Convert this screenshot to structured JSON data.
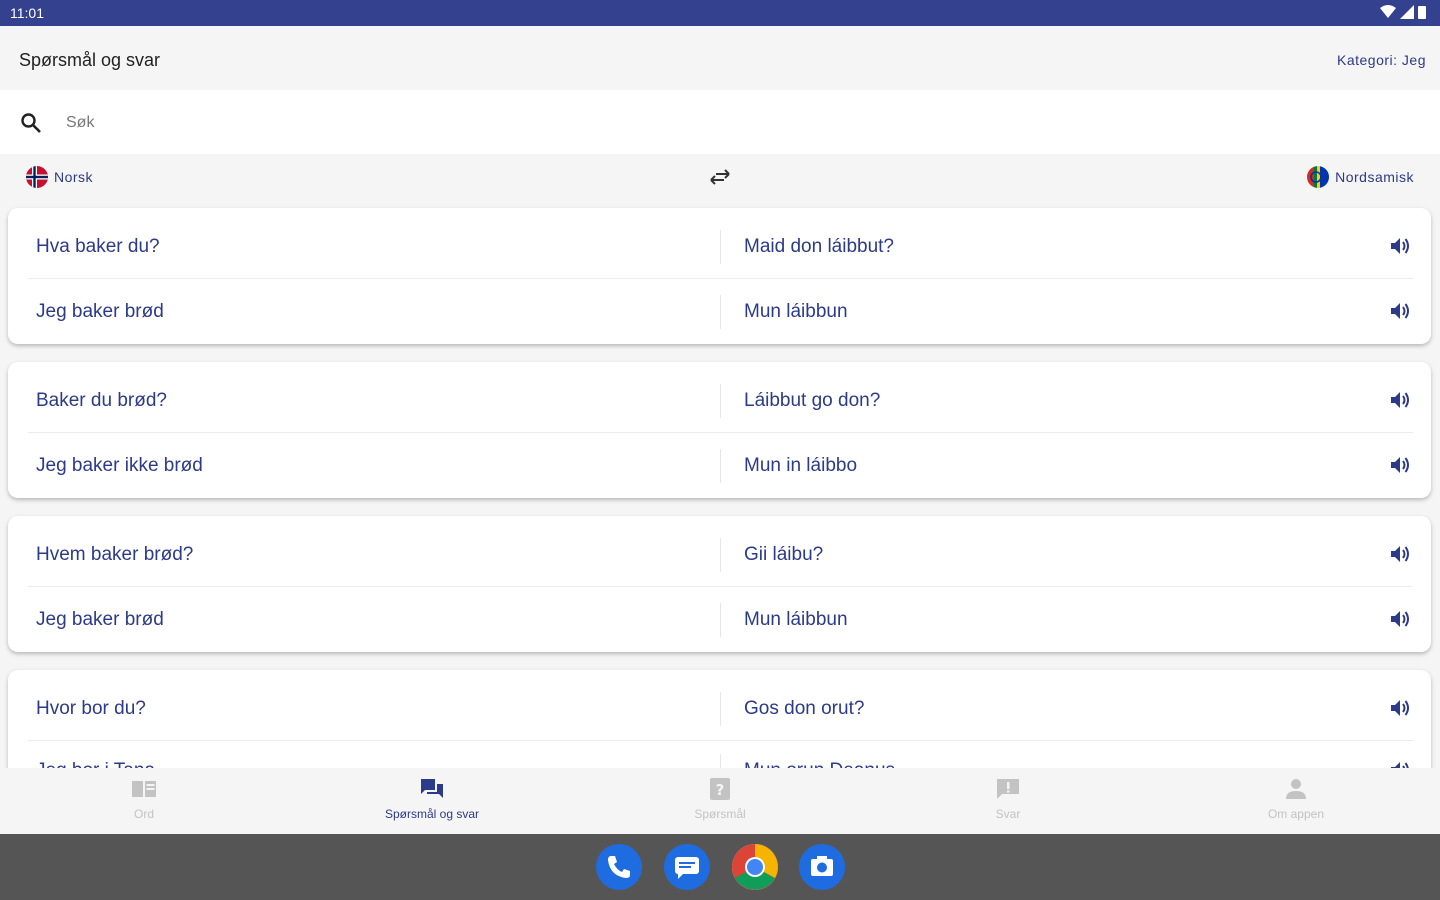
{
  "status_bar": {
    "time": "11:01"
  },
  "app_bar": {
    "title": "Spørsmål og svar",
    "category": "Kategori: Jeg"
  },
  "search": {
    "placeholder": "Søk"
  },
  "languages": {
    "source": "Norsk",
    "target": "Nordsamisk"
  },
  "cards": [
    {
      "rows": [
        {
          "norwegian": "Hva baker du?",
          "sami": "Maid don láibbut?"
        },
        {
          "norwegian": "Jeg baker brød",
          "sami": "Mun láibbun"
        }
      ]
    },
    {
      "rows": [
        {
          "norwegian": "Baker du brød?",
          "sami": "Láibbut go don?"
        },
        {
          "norwegian": "Jeg baker ikke brød",
          "sami": "Mun in láibbo"
        }
      ]
    },
    {
      "rows": [
        {
          "norwegian": "Hvem baker brød?",
          "sami": "Gii láibu?"
        },
        {
          "norwegian": "Jeg baker brød",
          "sami": "Mun láibbun"
        }
      ]
    },
    {
      "rows": [
        {
          "norwegian": "Hvor bor du?",
          "sami": "Gos don orut?"
        },
        {
          "norwegian": "Jeg bor i Tana",
          "sami": "Mun orun Deanus"
        }
      ]
    }
  ],
  "bottom_nav": [
    {
      "label": "Ord",
      "icon": "book-icon",
      "active": false
    },
    {
      "label": "Spørsmål og svar",
      "icon": "chat-icon",
      "active": true
    },
    {
      "label": "Spørsmål",
      "icon": "question-icon",
      "active": false
    },
    {
      "label": "Svar",
      "icon": "exclamation-icon",
      "active": false
    },
    {
      "label": "Om appen",
      "icon": "person-icon",
      "active": false
    }
  ],
  "dock": [
    {
      "name": "phone-app",
      "icon": "phone-icon"
    },
    {
      "name": "messages-app",
      "icon": "message-icon"
    },
    {
      "name": "chrome-app",
      "icon": "chrome-icon"
    },
    {
      "name": "camera-app",
      "icon": "camera-icon"
    }
  ],
  "colors": {
    "accent": "#2c3a8a",
    "status_bar": "#33418f",
    "dock": "#555555"
  }
}
